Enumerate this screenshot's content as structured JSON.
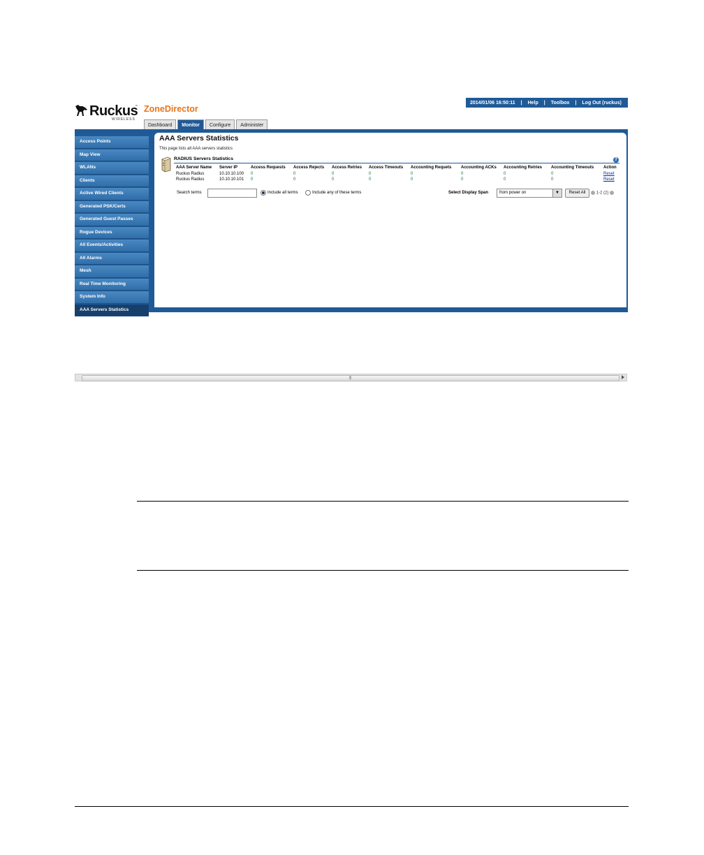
{
  "header": {
    "logo_text": "Ruckus",
    "logo_sub": "WIRELESS",
    "logo_tm": "™",
    "product": "ZoneDirector",
    "datetime": "2014/01/06  16:50:11",
    "separator": "|",
    "help": "Help",
    "toolbox": "Toolbox",
    "logout": "Log Out (ruckus)"
  },
  "tabs": [
    {
      "label": "Dashboard",
      "active": false
    },
    {
      "label": "Monitor",
      "active": true
    },
    {
      "label": "Configure",
      "active": false
    },
    {
      "label": "Administer",
      "active": false
    }
  ],
  "sidebar": {
    "items": [
      {
        "label": "Access Points"
      },
      {
        "label": "Map View"
      },
      {
        "label": "WLANs"
      },
      {
        "label": "Clients"
      },
      {
        "label": "Active Wired Clients"
      },
      {
        "label": "Generated PSK/Certs"
      },
      {
        "label": "Generated Guest Passes"
      },
      {
        "label": "Rogue Devices"
      },
      {
        "label": "All Events/Activities"
      },
      {
        "label": "All Alarms"
      },
      {
        "label": "Mesh"
      },
      {
        "label": "Real Time Monitoring"
      },
      {
        "label": "System Info"
      },
      {
        "label": "AAA Servers Statistics",
        "active": true
      }
    ]
  },
  "main": {
    "title": "AAA Servers Statistics",
    "description": "This page lists all AAA servers statistics",
    "section_title": "RADIUS Servers Statistics",
    "help_icon": "?",
    "table": {
      "columns": [
        "AAA Server Name",
        "Server IP",
        "Access Requests",
        "Access Rejects",
        "Access Retries",
        "Access Timeouts",
        "Accounting Requets",
        "Accounting ACKs",
        "Accounting Retries",
        "Accounting Timeouts",
        "Action"
      ],
      "rows": [
        [
          "Ruckus Radius",
          "10.10.10.100",
          "0",
          "0",
          "0",
          "0",
          "0",
          "0",
          "0",
          "0",
          "Reset"
        ],
        [
          "Ruckus Radius",
          "10.10.10.101",
          "0",
          "0",
          "0",
          "0",
          "0",
          "0",
          "0",
          "0",
          "Reset"
        ]
      ]
    },
    "search": {
      "label": "Search terms",
      "value": "",
      "radio_all": "Include all terms",
      "radio_any": "Include any of these terms",
      "span_label": "Select Display Span",
      "span_value": "from power on",
      "reset_all": "Reset All",
      "pager": "1-2 (2)"
    }
  },
  "colors": {
    "brand_blue": "#1f5a97",
    "product_orange": "#e8741c",
    "sidebar_blue": "#3a7ab7"
  }
}
